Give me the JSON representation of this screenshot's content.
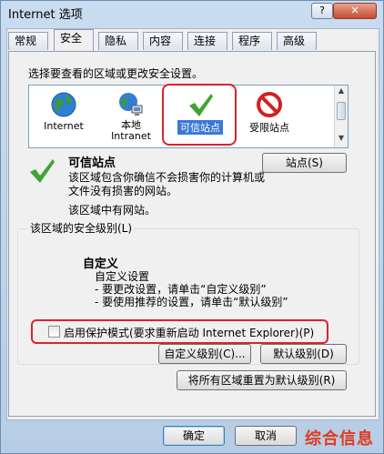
{
  "window": {
    "title": "Internet 选项",
    "help_label": "?",
    "close_label": "✕"
  },
  "tabs": [
    {
      "label": "常规"
    },
    {
      "label": "安全"
    },
    {
      "label": "隐私"
    },
    {
      "label": "内容"
    },
    {
      "label": "连接"
    },
    {
      "label": "程序"
    },
    {
      "label": "高级"
    }
  ],
  "security": {
    "zone_prompt": "选择要查看的区域或更改安全设置。",
    "zones": [
      {
        "label": "Internet",
        "icon": "globe-icon"
      },
      {
        "label": "本地\nIntranet",
        "icon": "intranet-icon"
      },
      {
        "label": "可信站点",
        "icon": "checkmark-icon"
      },
      {
        "label": "受限站点",
        "icon": "no-entry-icon"
      }
    ],
    "selected_zone_title": "可信站点",
    "selected_zone_desc_1": "该区域包含你确信不会损害你的计算机或",
    "selected_zone_desc_2": "文件没有损害的网站。",
    "zone_sites_note": "该区域中有网站。",
    "sites_button": "站点(S)",
    "security_level_label": "该区域的安全级别(L)",
    "custom_title": "自定义",
    "custom_line_1": "自定义设置",
    "custom_line_2": "- 要更改设置，请单击“自定义级别”",
    "custom_line_3": "- 要使用推荐的设置，请单击“默认级别”",
    "protected_mode_label": "启用保护模式(要求重新启动 Internet Explorer)(P)",
    "protected_mode_checked": false,
    "custom_level_button": "自定义级别(C)...",
    "default_level_button": "默认级别(D)",
    "reset_all_button": "将所有区域重置为默认级别(R)"
  },
  "footer": {
    "ok_button": "确定",
    "cancel_button": "取消"
  },
  "watermark": "综合信息",
  "colors": {
    "highlight_red": "#d9232d",
    "checkmark_green": "#3fa532",
    "watermark_red": "#e03a1e"
  }
}
